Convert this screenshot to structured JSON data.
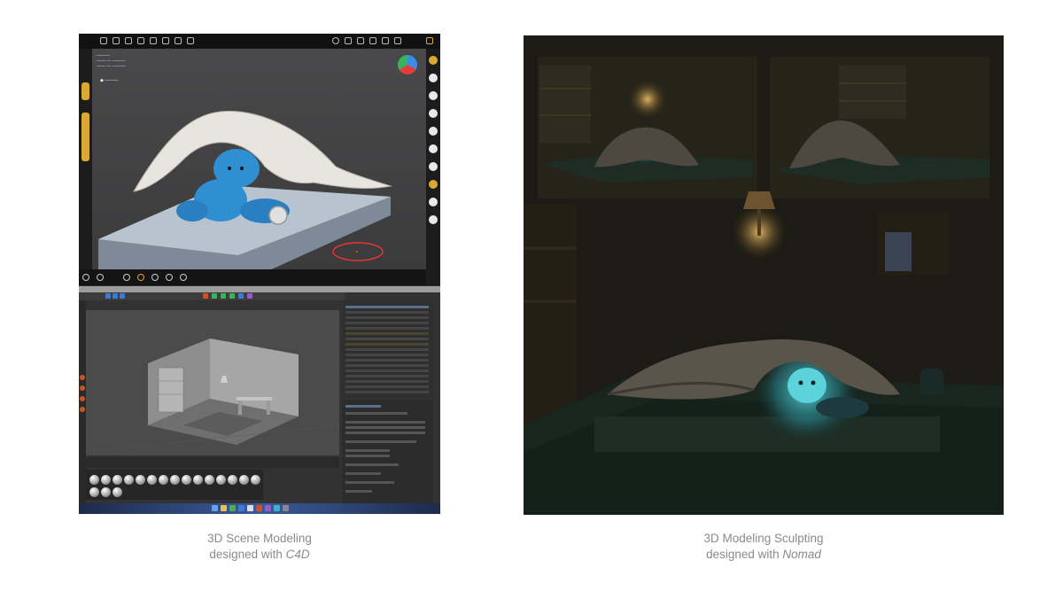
{
  "left_panel": {
    "caption_line1": "3D Scene Modeling",
    "caption_prefix": "designed with ",
    "caption_tool": "C4D"
  },
  "right_panel": {
    "caption_line1": "3D Modeling Sculpting",
    "caption_prefix": "designed with ",
    "caption_tool": "Nomad"
  },
  "colors": {
    "nomad_accent": "#d9a934",
    "bear_blue": "#2f8fd0",
    "blanket": "#e8e4de",
    "c4d_orange": "#d2511f",
    "render_glow": "#5fe0e8"
  }
}
